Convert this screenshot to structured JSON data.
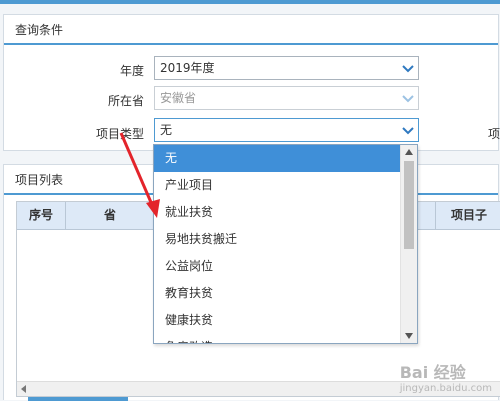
{
  "query_panel": {
    "title": "查询条件",
    "fields": [
      {
        "label": "年度",
        "value": "2019年度"
      },
      {
        "label": "所在省",
        "value": "安徽省"
      },
      {
        "label": "项目类型",
        "value": "无"
      }
    ],
    "right_cut_label": "项"
  },
  "list_panel": {
    "title": "项目列表",
    "columns": [
      "序号",
      "省",
      "项目子"
    ]
  },
  "dropdown": {
    "options": [
      "无",
      "产业项目",
      "就业扶贫",
      "易地扶贫搬迁",
      "公益岗位",
      "教育扶贫",
      "健康扶贫",
      "危房改造"
    ],
    "selected_index": 0
  },
  "watermark": {
    "text": "Bai 经验",
    "sub": "jingyan.baidu.com"
  },
  "colors": {
    "accent": "#4e9ad2",
    "selected": "#3f8fd8",
    "arrow": "#e3242b"
  }
}
